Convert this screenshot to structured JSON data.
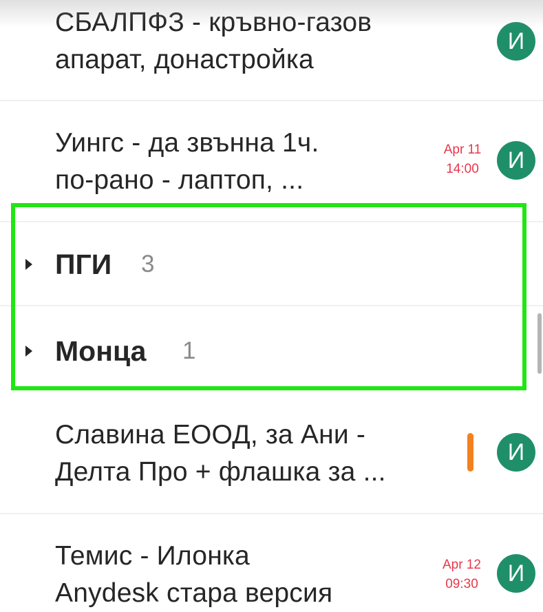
{
  "tasks": [
    {
      "title_line1": "СБАЛПФЗ - кръвно-газов",
      "title_line2": "апарат, донастройка",
      "avatar": "И"
    },
    {
      "title_line1": "Уингс - да звънна 1ч.",
      "title_line2": "по-рано - лаптоп, ...",
      "due_date": "Apr 11",
      "due_time": "14:00",
      "avatar": "И"
    },
    {
      "title_line1": "Славина ЕООД, за Ани -",
      "title_line2": "Делта Про + флашка за ...",
      "priority": "orange",
      "avatar": "И"
    },
    {
      "title_line1": "Темис - Илонка",
      "title_line2": "Anydesk стара версия",
      "due_date": "Apr 12",
      "due_time": "09:30",
      "avatar": "И"
    }
  ],
  "groups": [
    {
      "name": "ПГИ",
      "count": "3"
    },
    {
      "name": "Монца",
      "count": "1"
    }
  ],
  "colors": {
    "avatar": "#1f8f6a",
    "due": "#e8374b",
    "priority": "#f48120",
    "highlight": "#21e514"
  },
  "icons": {
    "group_toggle": "caret-right-icon"
  }
}
